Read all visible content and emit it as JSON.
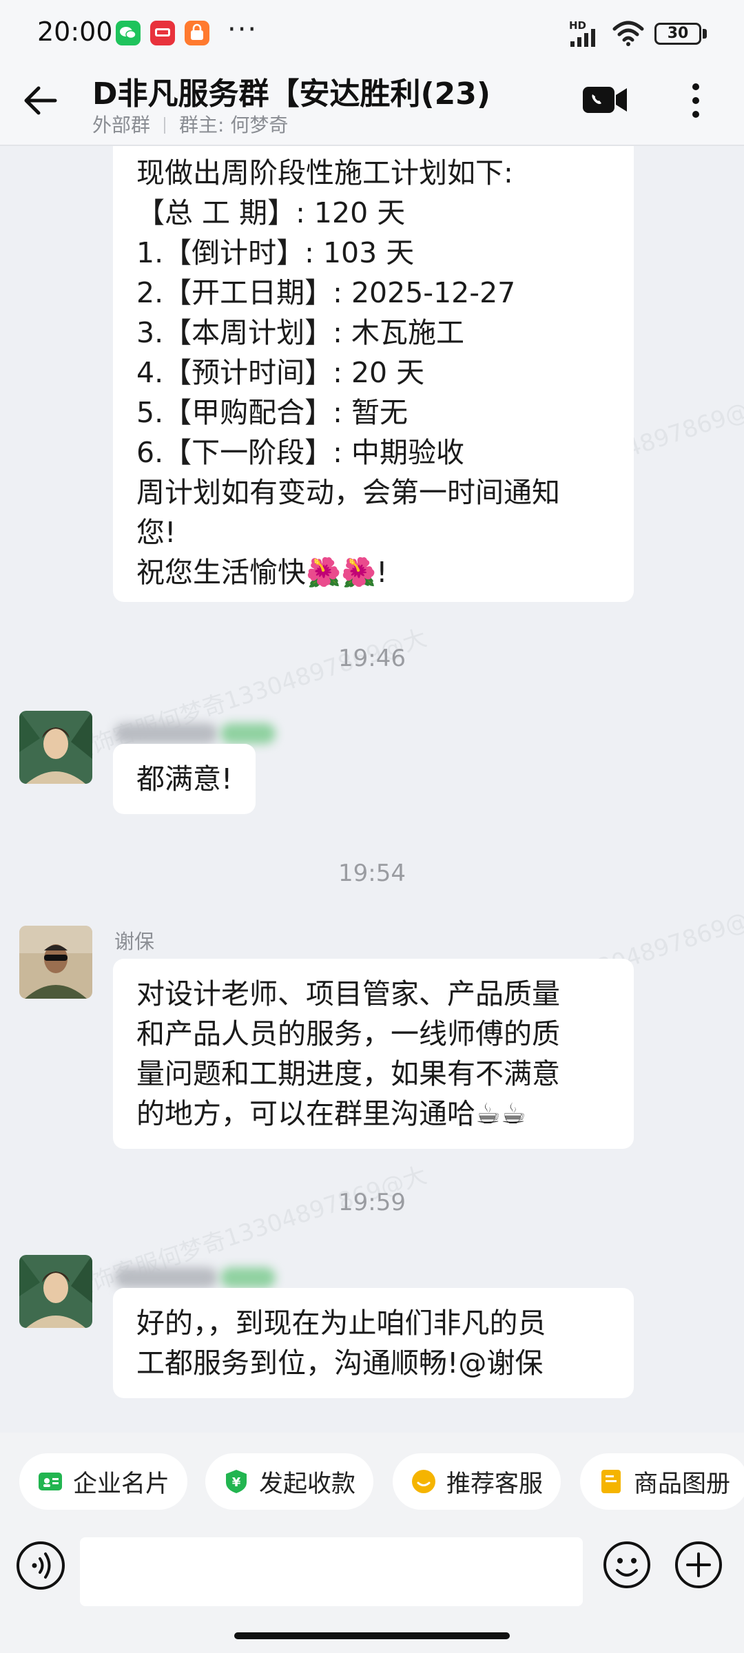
{
  "status_bar": {
    "time": "20:00",
    "more": "···",
    "network": "HD",
    "battery": "30",
    "app_icons": [
      "wechat-icon",
      "red-app-icon",
      "orange-app-icon"
    ]
  },
  "header": {
    "title": "D非凡服务群【安达胜利(23)",
    "tag": "外部群",
    "owner": "群主: 何梦奇"
  },
  "messages": [
    {
      "lines": [
        "现做出周阶段性施工计划如下:",
        "【总  工  期】: 120 天",
        "1.【倒计时】:  103 天",
        "2.【开工日期】: 2025-12-27",
        "3.【本周计划】:  木瓦施工",
        "4.【预计时间】: 20 天",
        "5.【甲购配合】: 暂无",
        "6.【下一阶段】: 中期验收",
        "周计划如有变动，会第一时间通知",
        "您!",
        "祝您生活愉快🌺🌺!"
      ]
    },
    {
      "time": "19:46",
      "text": "都满意!"
    },
    {
      "time": "19:54",
      "sender": "谢保",
      "lines": [
        "对设计老师、项目管家、产品质量",
        "和产品人员的服务，一线师傅的质",
        "量问题和工期进度，如果有不满意",
        "的地方，可以在群里沟通哈☕☕"
      ]
    },
    {
      "time": "19:59",
      "lines": [
        "好的，，到现在为止咱们非凡的员",
        "工都服务到位，沟通顺畅!@谢保"
      ]
    }
  ],
  "watermark_text": "非凡装饰客服何梦奇13304897869@大",
  "quick_actions": [
    {
      "label": "企业名片",
      "icon": "business-card-icon",
      "color": "#22b550"
    },
    {
      "label": "发起收款",
      "icon": "payment-icon",
      "color": "#22b550"
    },
    {
      "label": "推荐客服",
      "icon": "service-icon",
      "color": "#f5b400"
    },
    {
      "label": "商品图册",
      "icon": "catalog-icon",
      "color": "#f5b400"
    }
  ],
  "input": {
    "placeholder": ""
  }
}
